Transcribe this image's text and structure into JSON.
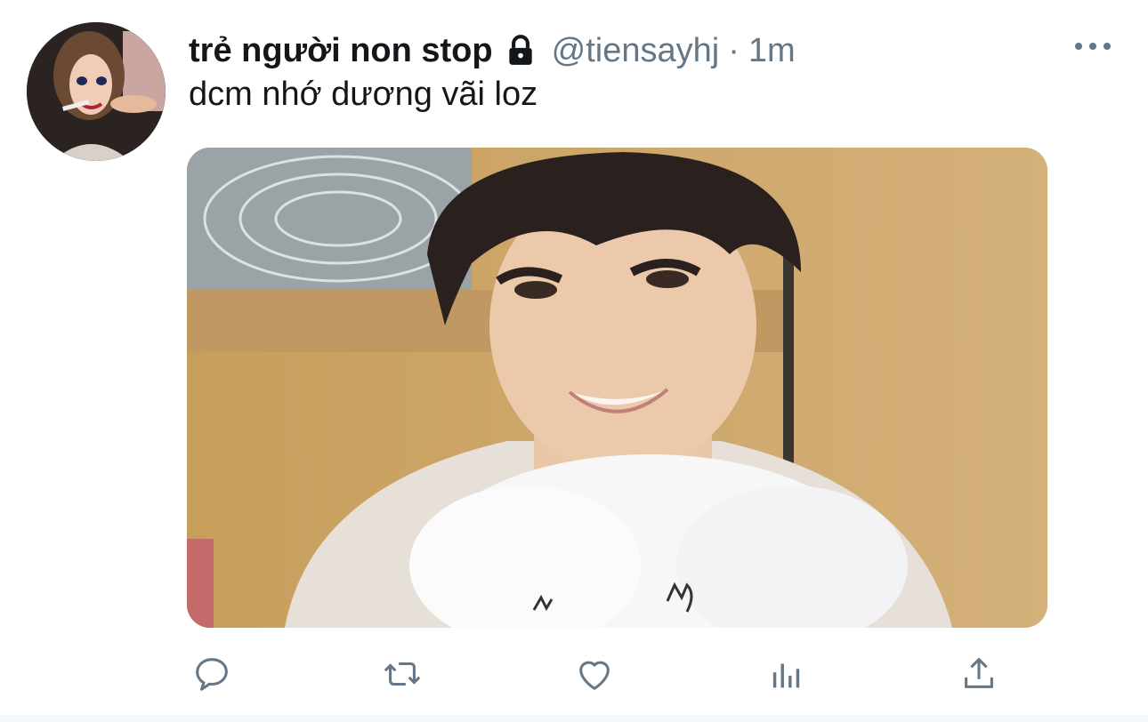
{
  "tweet": {
    "display_name": "trẻ người non stop",
    "handle": "@tiensayhj",
    "separator": "·",
    "time": "1m",
    "text": "dcm nhớ dương vãi loz",
    "protected_icon": "lock-icon",
    "more_icon": "more-icon"
  },
  "actions": [
    {
      "name": "reply",
      "icon": "reply-icon"
    },
    {
      "name": "retweet",
      "icon": "retweet-icon"
    },
    {
      "name": "like",
      "icon": "heart-icon"
    },
    {
      "name": "analytics",
      "icon": "analytics-icon"
    },
    {
      "name": "share",
      "icon": "share-icon"
    }
  ],
  "colors": {
    "text": "#14171a",
    "secondary": "#657786",
    "background": "#ffffff"
  }
}
